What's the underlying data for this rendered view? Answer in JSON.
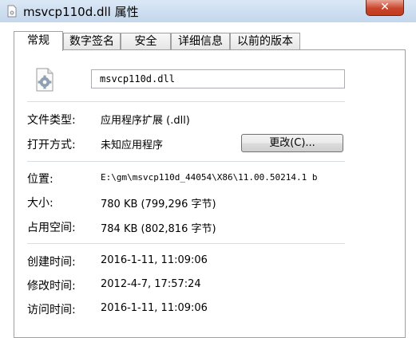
{
  "window": {
    "title": "msvcp110d.dll 属性",
    "close_glyph": "✕"
  },
  "tabs": [
    {
      "label": "常规",
      "active": true
    },
    {
      "label": "数字签名",
      "active": false
    },
    {
      "label": "安全",
      "active": false
    },
    {
      "label": "详细信息",
      "active": false
    },
    {
      "label": "以前的版本",
      "active": false
    }
  ],
  "general": {
    "file_name": "msvcp110d.dll",
    "file_type_label": "文件类型:",
    "file_type_value": "应用程序扩展 (.dll)",
    "opens_with_label": "打开方式:",
    "opens_with_value": "未知应用程序",
    "change_button": "更改(C)...",
    "location_label": "位置:",
    "location_value": "E:\\gm\\msvcp110d_44054\\X86\\11.00.50214.1 b",
    "size_label": "大小:",
    "size_value": "780 KB (799,296 字节)",
    "size_on_disk_label": "占用空间:",
    "size_on_disk_value": "784 KB (802,816 字节)",
    "created_label": "创建时间:",
    "created_value": "2016-1-11, 11:09:06",
    "modified_label": "修改时间:",
    "modified_value": "2012-4-7, 17:57:24",
    "accessed_label": "访问时间:",
    "accessed_value": "2016-1-11, 11:09:06"
  },
  "icons": {
    "title": "dll-file-icon",
    "file": "dll-gear-file-icon",
    "close": "close-icon"
  },
  "colors": {
    "titlebar": "#c3d6ec",
    "close_button": "#c9452b",
    "separator": "#d5dfe5",
    "panel_border": "#a0a0a0"
  }
}
